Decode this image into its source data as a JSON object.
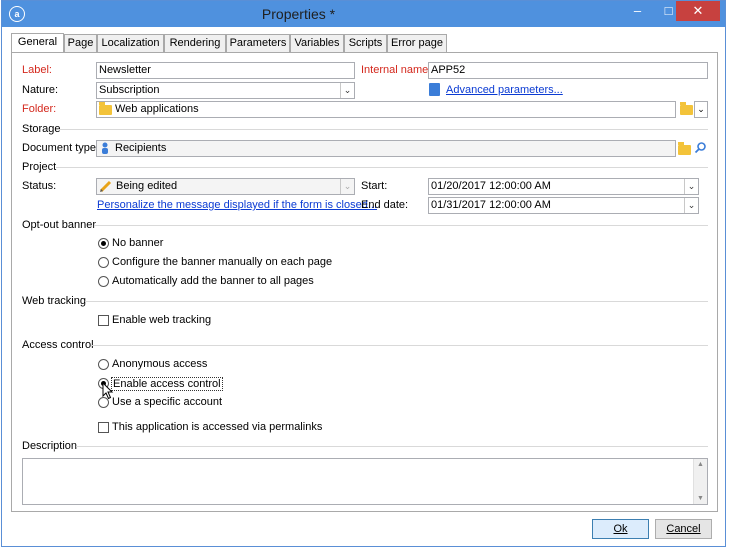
{
  "window": {
    "title": "Properties *"
  },
  "tabs": [
    "General",
    "Page",
    "Localization",
    "Rendering",
    "Parameters",
    "Variables",
    "Scripts",
    "Error page"
  ],
  "general": {
    "label_label": "Label:",
    "label_value": "Newsletter",
    "internal_name_label": "Internal name:",
    "internal_name_value": "APP52",
    "nature_label": "Nature:",
    "nature_value": "Subscription",
    "advanced_parameters_link": "Advanced parameters...",
    "folder_label": "Folder:",
    "folder_value": "Web applications"
  },
  "storage": {
    "section_title": "Storage",
    "document_type_label": "Document type:",
    "document_type_value": "Recipients"
  },
  "project": {
    "section_title": "Project",
    "status_label": "Status:",
    "status_value": "Being edited",
    "personalize_link": "Personalize the message displayed if the form is closed...",
    "start_label": "Start:",
    "start_value": "01/20/2017 12:00:00 AM",
    "end_date_label": "End date:",
    "end_date_value": "01/31/2017 12:00:00 AM"
  },
  "optout": {
    "section_title": "Opt-out banner",
    "options": [
      "No banner",
      "Configure the banner manually on each page",
      "Automatically add the banner to all pages"
    ],
    "selected_index": 0
  },
  "web_tracking": {
    "section_title": "Web tracking",
    "checkbox_label": "Enable web tracking",
    "checked": false
  },
  "access_control": {
    "section_title": "Access control",
    "options": [
      "Anonymous access",
      "Enable access control",
      "Use a specific account"
    ],
    "selected_index": 1,
    "permalinks_label": "This application is accessed via permalinks",
    "permalinks_checked": false
  },
  "description": {
    "section_title": "Description",
    "value": ""
  },
  "buttons": {
    "ok": "Ok",
    "cancel": "Cancel"
  },
  "colors": {
    "title_bar": "#4f91de",
    "required_label": "#d4281d",
    "link": "#0b3bd3",
    "close_button": "#c7413f"
  }
}
